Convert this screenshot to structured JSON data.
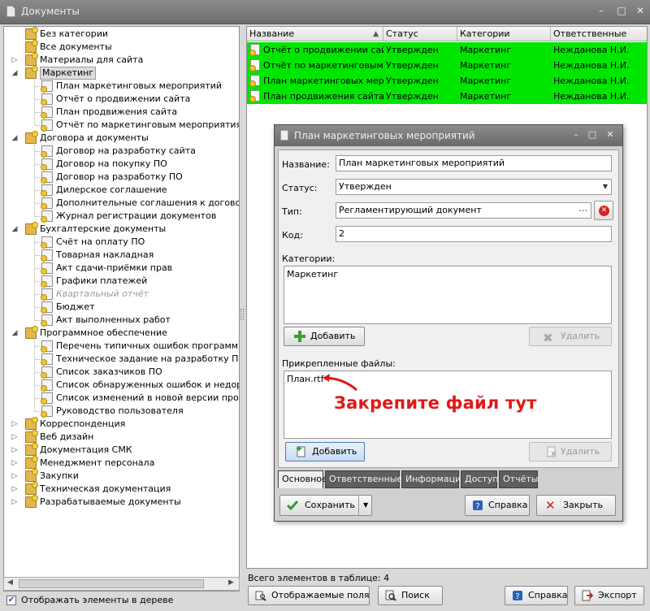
{
  "window": {
    "title": "Документы"
  },
  "tree": {
    "items": [
      {
        "label": "Без категории",
        "level": 0,
        "icon": "folder-icon",
        "expander": ""
      },
      {
        "label": "Все документы",
        "level": 0,
        "icon": "folder-icon",
        "expander": ""
      },
      {
        "label": "Материалы для сайта",
        "level": 0,
        "icon": "folder-icon",
        "expander": "collapsed"
      },
      {
        "label": "Маркетинг",
        "level": 0,
        "icon": "folder-icon",
        "expander": "expanded",
        "selected": true
      },
      {
        "label": "План маркетинговых мероприятий",
        "level": 1,
        "icon": "document-icon"
      },
      {
        "label": "Отчёт о продвижении сайта",
        "level": 1,
        "icon": "document-icon"
      },
      {
        "label": "План продвижения сайта",
        "level": 1,
        "icon": "document-icon"
      },
      {
        "label": "Отчёт по маркетинговым мероприятиям",
        "level": 1,
        "icon": "document-icon"
      },
      {
        "label": "Договора и документы",
        "level": 0,
        "icon": "folder-icon",
        "expander": "expanded"
      },
      {
        "label": "Договор на разработку сайта",
        "level": 1,
        "icon": "document-icon"
      },
      {
        "label": "Договор на покупку ПО",
        "level": 1,
        "icon": "document-icon"
      },
      {
        "label": "Договор на разработку ПО",
        "level": 1,
        "icon": "document-icon"
      },
      {
        "label": "Дилерское соглашение",
        "level": 1,
        "icon": "document-icon"
      },
      {
        "label": "Дополнительные соглашения к договорам",
        "level": 1,
        "icon": "document-icon"
      },
      {
        "label": "Журнал регистрации документов",
        "level": 1,
        "icon": "document-icon"
      },
      {
        "label": "Бухгалтерские документы",
        "level": 0,
        "icon": "folder-icon",
        "expander": "expanded"
      },
      {
        "label": "Счёт на оплату ПО",
        "level": 1,
        "icon": "document-icon"
      },
      {
        "label": "Товарная накладная",
        "level": 1,
        "icon": "document-icon"
      },
      {
        "label": "Акт сдачи-приёмки прав",
        "level": 1,
        "icon": "document-icon"
      },
      {
        "label": "Графики платежей",
        "level": 1,
        "icon": "document-icon"
      },
      {
        "label": "Квартальный отчёт",
        "level": 1,
        "icon": "document-icon",
        "disabled": true
      },
      {
        "label": "Бюджет",
        "level": 1,
        "icon": "document-icon"
      },
      {
        "label": "Акт выполненных работ",
        "level": 1,
        "icon": "document-icon"
      },
      {
        "label": "Программное обеспечение",
        "level": 0,
        "icon": "folder-icon",
        "expander": "expanded"
      },
      {
        "label": "Перечень типичных ошибок программного с",
        "level": 1,
        "icon": "document-icon"
      },
      {
        "label": "Техническое задание на разработку ПО",
        "level": 1,
        "icon": "document-icon"
      },
      {
        "label": "Список заказчиков ПО",
        "level": 1,
        "icon": "document-icon"
      },
      {
        "label": "Список обнаруженных ошибок и недоработ",
        "level": 1,
        "icon": "document-icon"
      },
      {
        "label": "Список изменений в новой версии программ",
        "level": 1,
        "icon": "document-icon"
      },
      {
        "label": "Руководство пользователя",
        "level": 1,
        "icon": "document-icon"
      },
      {
        "label": "Корреспонденция",
        "level": 0,
        "icon": "folder-icon",
        "expander": "collapsed"
      },
      {
        "label": "Веб дизайн",
        "level": 0,
        "icon": "folder-icon",
        "expander": "collapsed"
      },
      {
        "label": "Документация СМК",
        "level": 0,
        "icon": "folder-icon",
        "expander": "collapsed"
      },
      {
        "label": "Менеджмент персонала",
        "level": 0,
        "icon": "folder-icon",
        "expander": "collapsed"
      },
      {
        "label": "Закупки",
        "level": 0,
        "icon": "folder-icon",
        "expander": "collapsed"
      },
      {
        "label": "Техническая документация",
        "level": 0,
        "icon": "folder-icon",
        "expander": "collapsed"
      },
      {
        "label": "Разрабатываемые документы",
        "level": 0,
        "icon": "folder-icon",
        "expander": "collapsed"
      }
    ],
    "show_in_tree_label": "Отображать элементы в дереве",
    "show_in_tree_checked": true
  },
  "grid": {
    "columns": [
      "Название",
      "Статус",
      "Категории",
      "Ответственные"
    ],
    "rows": [
      [
        "Отчёт о продвижении сайта",
        "Утвержден",
        "Маркетинг",
        "Нежданова Н.И."
      ],
      [
        "Отчёт по маркетинговым мер",
        "Утвержден",
        "Маркетинг",
        "Нежданова Н.И."
      ],
      [
        "План маркетинговых меропр",
        "Утвержден",
        "Маркетинг",
        "Нежданова Н.И."
      ],
      [
        "План продвижения сайта",
        "Утвержден",
        "Маркетинг",
        "Нежданова Н.И."
      ]
    ],
    "row_color": "#00e600",
    "total_label": "Всего элементов в таблице: 4"
  },
  "bottom_toolbar": {
    "fields_label": "Отображаемые поля",
    "search_label": "Поиск",
    "help_label": "Справка",
    "export_label": "Экспорт"
  },
  "dialog": {
    "title": "План маркетинговых мероприятий",
    "name_label": "Название:",
    "name_value": "План маркетинговых мероприятий",
    "status_label": "Статус:",
    "status_value": "Утвержден",
    "type_label": "Тип:",
    "type_value": "Регламентирующий документ",
    "code_label": "Код:",
    "code_value": "2",
    "categories_label": "Категории:",
    "categories_value": "Маркетинг",
    "add_label": "Добавить",
    "delete_label": "Удалить",
    "files_label": "Прикрепленные файлы:",
    "files_value": "План.rtf",
    "annotation": "Закрепите файл тут",
    "tabs": [
      "Основное",
      "Ответственные",
      "Информация",
      "Доступ",
      "Отчёты"
    ],
    "save_label": "Сохранить",
    "help_label": "Справка",
    "close_label": "Закрыть"
  },
  "colors": {
    "accent_red": "#e01818",
    "row_highlight": "#00e600"
  }
}
